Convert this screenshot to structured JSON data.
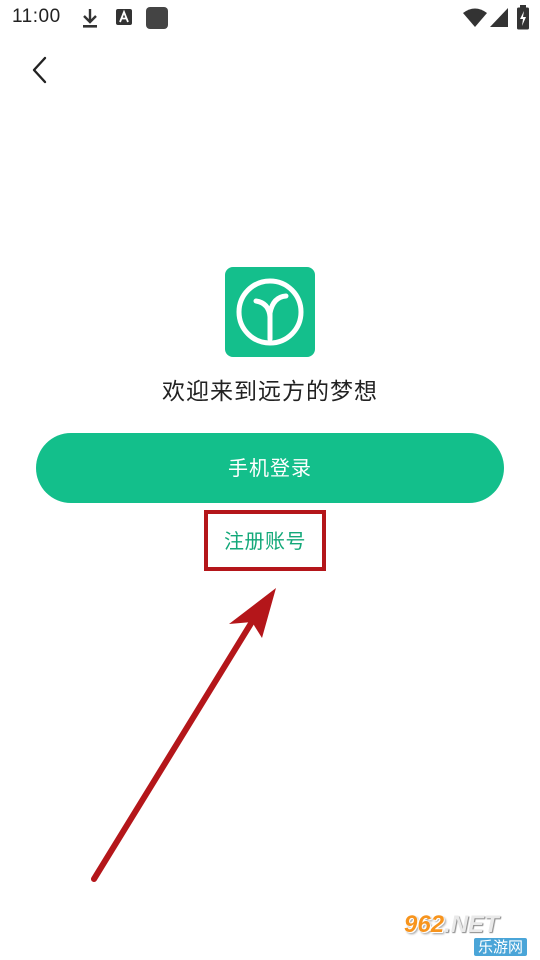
{
  "status_bar": {
    "time": "11:00",
    "left_icons": [
      "download-icon",
      "a-notification-icon",
      "app-square-icon"
    ],
    "right_icons": [
      "wifi-icon",
      "signal-icon",
      "battery-charging-icon"
    ]
  },
  "nav": {
    "back_icon": "chevron-left-icon"
  },
  "app": {
    "logo_icon": "sprout-icon",
    "logo_color": "#14bf8c"
  },
  "welcome_text": "欢迎来到远方的梦想",
  "buttons": {
    "phone_login": "手机登录",
    "register": "注册账号",
    "primary_color": "#13bf8b",
    "link_color": "#13a879"
  },
  "annotation": {
    "highlight_color": "#b4161a"
  },
  "watermark": {
    "number": "962",
    "domain": ".NET",
    "site_name": "乐游网"
  }
}
